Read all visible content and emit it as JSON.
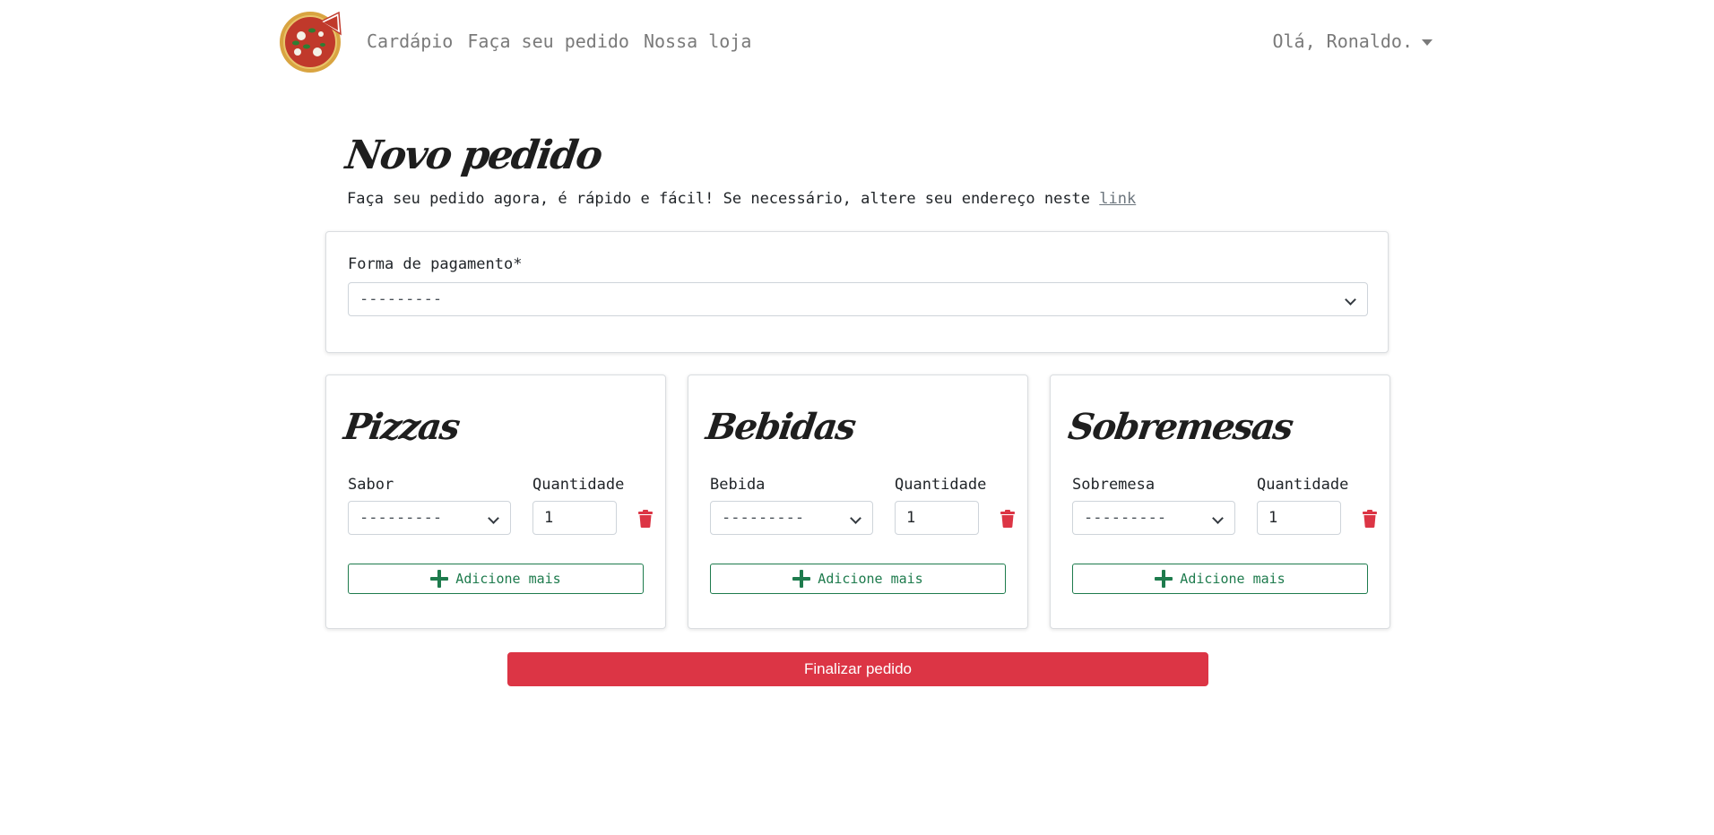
{
  "nav": {
    "links": [
      "Cardápio",
      "Faça seu pedido",
      "Nossa loja"
    ],
    "user_greeting": "Olá, Ronaldo."
  },
  "page": {
    "title": "Novo pedido",
    "intro_text": "Faça seu pedido agora, é rápido e fácil! Se necessário, altere seu endereço neste ",
    "intro_link": "link"
  },
  "payment": {
    "label": "Forma de pagamento*",
    "selected": "---------"
  },
  "sections": [
    {
      "title": "Pizzas",
      "select_label": "Sabor",
      "qty_label": "Quantidade",
      "selected": "---------",
      "qty": "1",
      "add_label": "Adicione mais"
    },
    {
      "title": "Bebidas",
      "select_label": "Bebida",
      "qty_label": "Quantidade",
      "selected": "---------",
      "qty": "1",
      "add_label": "Adicione mais"
    },
    {
      "title": "Sobremesas",
      "select_label": "Sobremesa",
      "qty_label": "Quantidade",
      "selected": "---------",
      "qty": "1",
      "add_label": "Adicione mais"
    }
  ],
  "submit_label": "Finalizar pedido",
  "colors": {
    "primary_danger": "#dc3545",
    "success_outline": "#1e7b4d",
    "nav_text": "#7a7a7a"
  },
  "icons": {
    "logo": "pizza-logo",
    "trash": "trash-icon",
    "plus": "plus-icon",
    "caret": "caret-down-icon",
    "chevron": "chevron-down-icon"
  }
}
